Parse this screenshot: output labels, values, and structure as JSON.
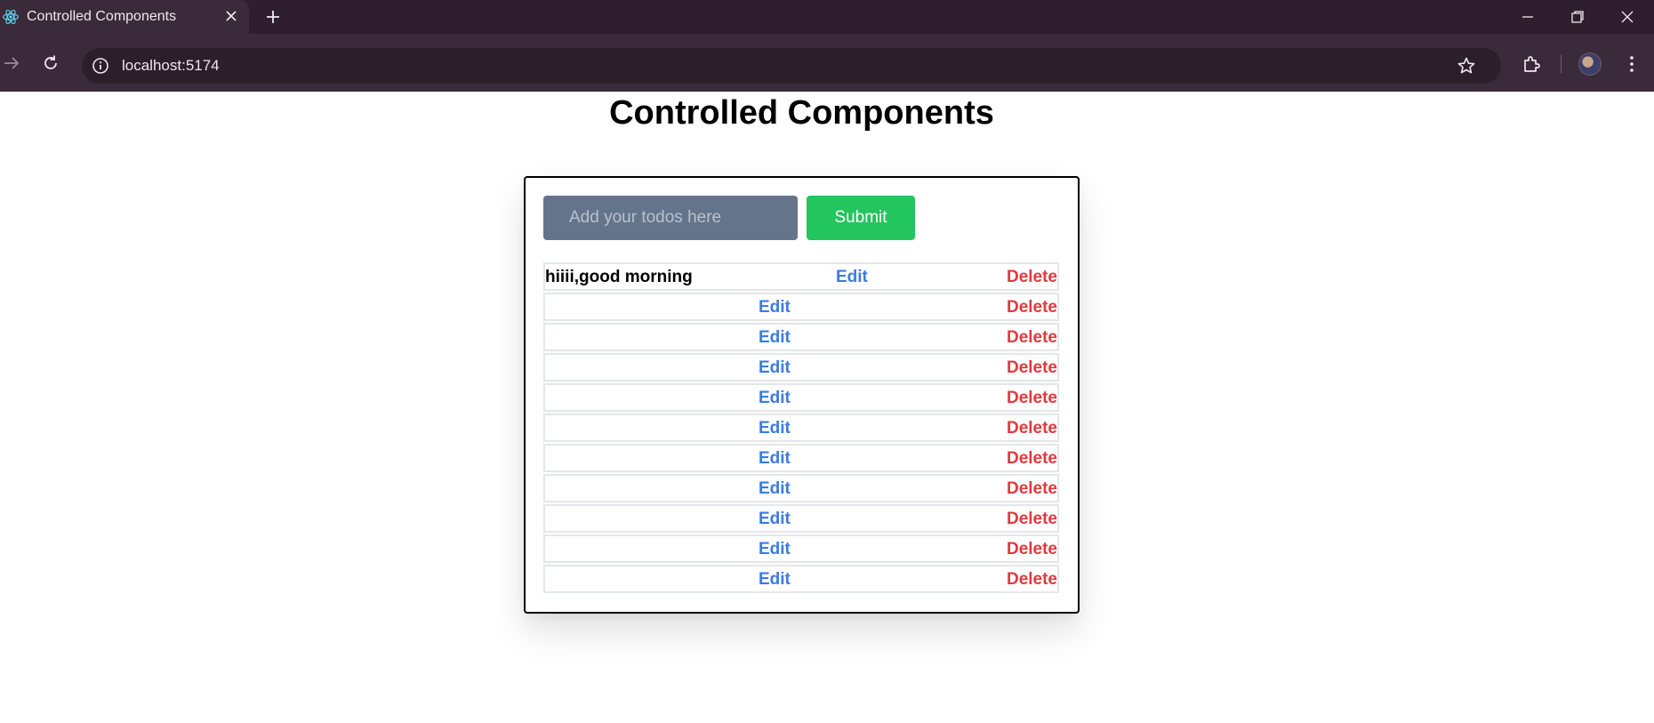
{
  "browser": {
    "tab_title": "Controlled Components",
    "url": "localhost:5174"
  },
  "page": {
    "title": "Controlled Components",
    "input_placeholder": "Add your todos here",
    "input_value": "",
    "submit_label": "Submit"
  },
  "todos": [
    {
      "text": "hiiii,good morning",
      "edit": "Edit",
      "delete": "Delete"
    },
    {
      "text": "",
      "edit": "Edit",
      "delete": "Delete"
    },
    {
      "text": "",
      "edit": "Edit",
      "delete": "Delete"
    },
    {
      "text": "",
      "edit": "Edit",
      "delete": "Delete"
    },
    {
      "text": "",
      "edit": "Edit",
      "delete": "Delete"
    },
    {
      "text": "",
      "edit": "Edit",
      "delete": "Delete"
    },
    {
      "text": "",
      "edit": "Edit",
      "delete": "Delete"
    },
    {
      "text": "",
      "edit": "Edit",
      "delete": "Delete"
    },
    {
      "text": "",
      "edit": "Edit",
      "delete": "Delete"
    },
    {
      "text": "",
      "edit": "Edit",
      "delete": "Delete"
    },
    {
      "text": "",
      "edit": "Edit",
      "delete": "Delete"
    }
  ],
  "colors": {
    "input_bg": "#64748b",
    "submit_bg": "#22c55e",
    "edit": "#3b7be0",
    "delete": "#e0393e"
  }
}
